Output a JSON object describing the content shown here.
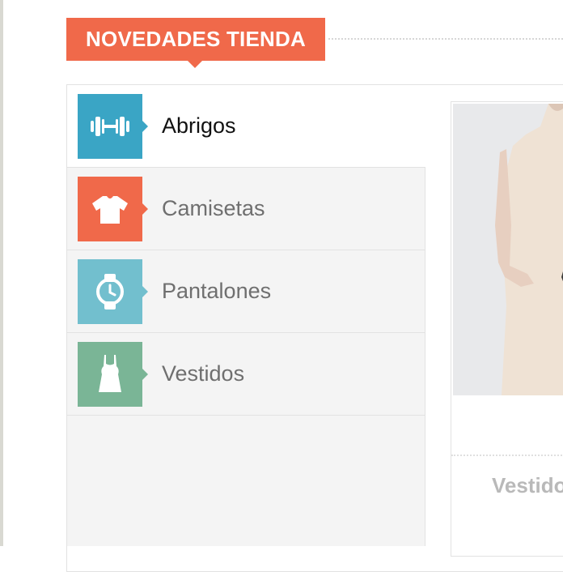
{
  "section": {
    "title": "NOVEDADES TIENDA"
  },
  "tabs": [
    {
      "label": "Abrigos",
      "icon": "dumbbell-icon",
      "color": "#3aa5c5",
      "active": true
    },
    {
      "label": "Camisetas",
      "icon": "tshirt-icon",
      "color": "#f0694a",
      "active": false
    },
    {
      "label": "Pantalones",
      "icon": "watch-icon",
      "color": "#72bfce",
      "active": false
    },
    {
      "label": "Vestidos",
      "icon": "dress-icon",
      "color": "#7ab596",
      "active": false
    }
  ],
  "product": {
    "name": "Vestido"
  },
  "colors": {
    "accent": "#f0694a",
    "panel": "#f4f4f4",
    "border": "#e2e2e2"
  }
}
